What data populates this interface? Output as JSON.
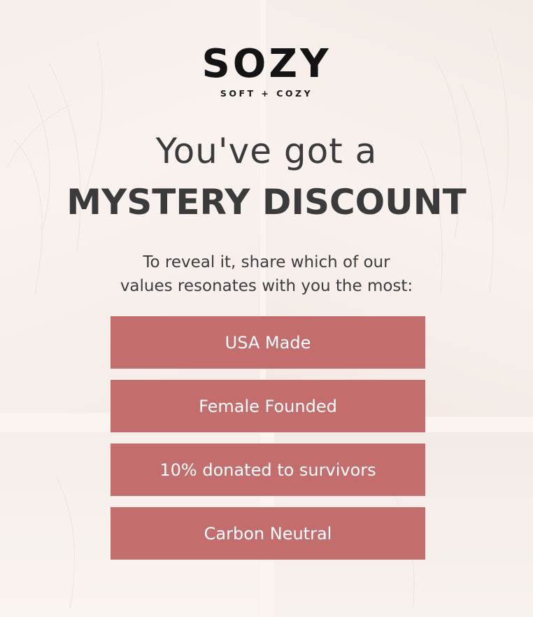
{
  "brand": {
    "logo_text": "SOZY",
    "tagline": "SOFT + COZY"
  },
  "headline": {
    "line1": "You've got a",
    "line2": "MYSTERY DISCOUNT"
  },
  "prompt": {
    "line1": "To reveal it, share which of our",
    "line2": "values resonates with you the most:"
  },
  "options": [
    {
      "label": "USA Made"
    },
    {
      "label": "Female Founded"
    },
    {
      "label": "10% donated to survivors"
    },
    {
      "label": "Carbon Neutral"
    }
  ],
  "colors": {
    "background": "#fbf4f1",
    "button": "#c46d6d",
    "button_text": "#ffffff",
    "heading_text": "#3b3b3b",
    "logo": "#141414"
  }
}
